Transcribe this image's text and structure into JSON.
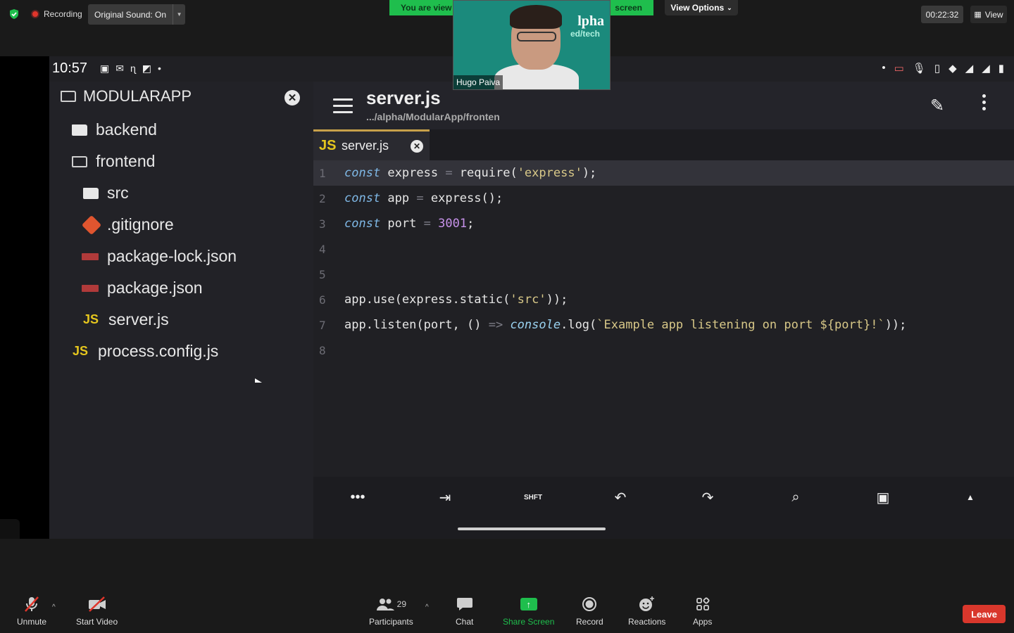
{
  "zoom": {
    "recording_label": "Recording",
    "original_sound": "Original Sound: On",
    "viewing_banner_left": "You are view",
    "viewing_banner_right": "screen",
    "view_options": "View Options",
    "timer": "00:22:32",
    "view_label": "View",
    "participant_name": "Hugo Paiva",
    "video_brand_top": "lpha",
    "video_brand_bottom": "ed/tech",
    "controls": {
      "unmute": "Unmute",
      "start_video": "Start Video",
      "participants": "Participants",
      "participants_count": "29",
      "chat": "Chat",
      "share_screen": "Share Screen",
      "record": "Record",
      "reactions": "Reactions",
      "apps": "Apps",
      "leave": "Leave"
    },
    "colors": {
      "accent_green": "#1fbe4d",
      "leave_red": "#d9372c"
    }
  },
  "phone": {
    "status_time": "10:57",
    "file_tree": {
      "root": "MODULARAPP",
      "items": [
        {
          "label": "backend",
          "icon": "folder-solid-icon"
        },
        {
          "label": "frontend",
          "icon": "folder-outline-icon"
        },
        {
          "label": "src",
          "icon": "folder-solid-icon"
        },
        {
          "label": ".gitignore",
          "icon": "git-icon"
        },
        {
          "label": "package-lock.json",
          "icon": "npm-icon"
        },
        {
          "label": "package.json",
          "icon": "npm-icon"
        },
        {
          "label": "server.js",
          "icon": "js-icon"
        },
        {
          "label": "process.config.js",
          "icon": "js-icon"
        }
      ]
    },
    "editor": {
      "title": "server.js",
      "path": ".../alpha/ModularApp/fronten",
      "tab_label": "server.js",
      "tab_icon_text": "JS",
      "lines": [
        {
          "n": "1",
          "code": "const express = require('express');"
        },
        {
          "n": "2",
          "code": "const app = express();"
        },
        {
          "n": "3",
          "code": "const port = 3001;"
        },
        {
          "n": "4",
          "code": ""
        },
        {
          "n": "5",
          "code": ""
        },
        {
          "n": "6",
          "code": "app.use(express.static('src'));"
        },
        {
          "n": "7",
          "code": "app.listen(port, () => console.log(`Example app listening on port ${port}!`));"
        },
        {
          "n": "8",
          "code": ""
        }
      ],
      "toolbar": {
        "shift_label": "SHFT"
      }
    }
  }
}
